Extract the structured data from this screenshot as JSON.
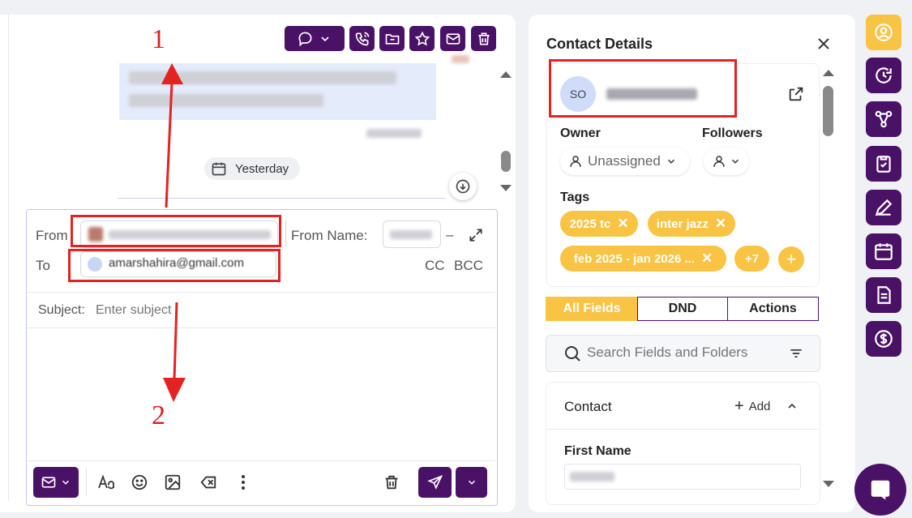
{
  "conversation": {
    "message_status": "",
    "date_divider": "Yesterday"
  },
  "composer": {
    "from_label": "From",
    "from_name_label": "From Name:",
    "from_name_separator": "–",
    "to_label": "To",
    "to_value": "amarshahira@gmail.com",
    "cc_label": "CC",
    "bcc_label": "BCC",
    "subject_label": "Subject:",
    "subject_placeholder": "Enter subject"
  },
  "annotations": {
    "arrow_1_label": "1",
    "arrow_2_label": "2"
  },
  "contact_panel": {
    "title": "Contact Details",
    "avatar_initials": "SO",
    "owner_label": "Owner",
    "owner_value": "Unassigned",
    "followers_label": "Followers",
    "tags_label": "Tags",
    "tags": [
      "2025 tc",
      "inter jazz",
      "feb 2025 - jan 2026 ..."
    ],
    "more_tags": "+7",
    "tabs": [
      "All Fields",
      "DND",
      "Actions"
    ],
    "search_placeholder": "Search Fields and Folders",
    "section_title": "Contact",
    "add_label": "Add",
    "first_name_label": "First Name"
  },
  "colors": {
    "brand": "#4a1266",
    "accent": "#f9c343",
    "annotation": "#e52222"
  }
}
